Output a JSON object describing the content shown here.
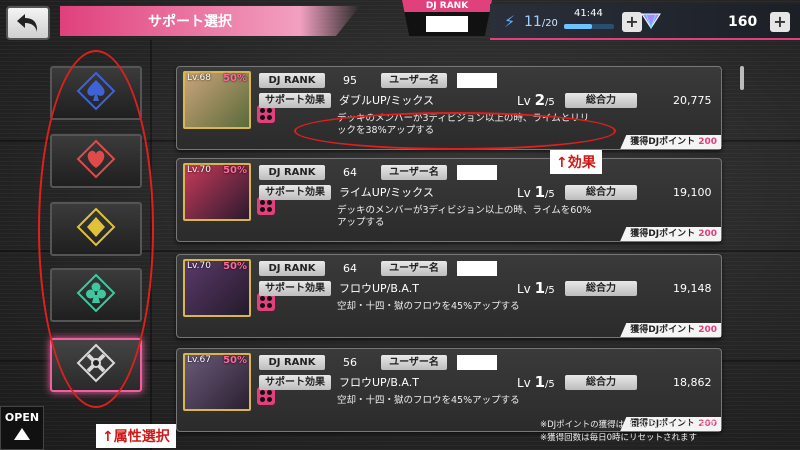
{
  "header": {
    "title": "サポート選択",
    "dj_rank_label": "DJ RANK",
    "stamina_current": "11",
    "stamina_max": "/20",
    "stamina_timer": "41:44",
    "stamina_fill_fraction": 0.55,
    "gem_count": "160",
    "plus": "+"
  },
  "attributes": [
    {
      "name": "spade-icon",
      "color": "#3f62d6",
      "selected": false
    },
    {
      "name": "heart-icon",
      "color": "#e04a4a",
      "selected": false
    },
    {
      "name": "diamond-icon",
      "color": "#e0c23a",
      "selected": false
    },
    {
      "name": "club-icon",
      "color": "#3fc7a0",
      "selected": false
    },
    {
      "name": "all-attributes-icon",
      "color": "#d8d8d8",
      "selected": true
    }
  ],
  "labels": {
    "dj_rank": "DJ RANK",
    "user_name": "ユーザー名",
    "support_effect": "サポート効果",
    "total_power": "総合力",
    "dj_points": "獲得DJポイント"
  },
  "cards": [
    {
      "lv": "Lv.68",
      "pct": "50%",
      "rank": "95",
      "effect_name": "ダブルUP/ミックス",
      "lv_current": "2",
      "lv_max": "/5",
      "power": "20,775",
      "desc": "デッキのメンバーが3ディビジョン以上の時、ライムとリリックを38%アップする",
      "points": "200",
      "frame": "#d8b650",
      "art": [
        "#caa57a",
        "#5b6a3a"
      ]
    },
    {
      "lv": "Lv.70",
      "pct": "50%",
      "rank": "64",
      "effect_name": "ライムUP/ミックス",
      "lv_current": "1",
      "lv_max": "/5",
      "power": "19,100",
      "desc": "デッキのメンバーが3ディビジョン以上の時、ライムを60%アップする",
      "points": "200",
      "frame": "#d8b650",
      "art": [
        "#c83a5a",
        "#2a1a2e"
      ]
    },
    {
      "lv": "Lv.70",
      "pct": "50%",
      "rank": "64",
      "effect_name": "フロウUP/B.A.T",
      "lv_current": "1",
      "lv_max": "/5",
      "power": "19,148",
      "desc": "空却・十四・獄のフロウを45%アップする",
      "points": "200",
      "frame": "#d8b650",
      "art": [
        "#5a3a6a",
        "#241a2a"
      ]
    },
    {
      "lv": "Lv.67",
      "pct": "50%",
      "rank": "56",
      "effect_name": "フロウUP/B.A.T",
      "lv_current": "1",
      "lv_max": "/5",
      "power": "18,862",
      "desc": "空却・十四・獄のフロウを45%アップする",
      "points": "200",
      "frame": "#d8b650",
      "art": [
        "#6a5a7a",
        "#2a2030"
      ]
    }
  ],
  "annotations": {
    "effect": "↑効果",
    "attribute": "↑属性選択"
  },
  "open_button": "OPEN",
  "notes": [
    "※DJポイントの獲得は1日20回までとなります",
    "※獲得回数は毎日0時にリセットされます"
  ]
}
